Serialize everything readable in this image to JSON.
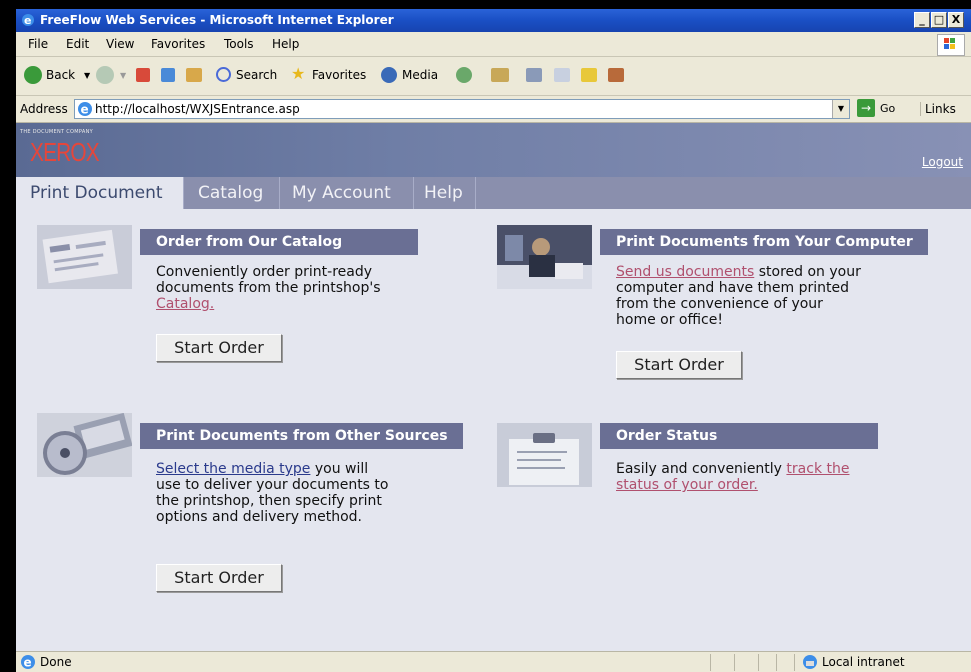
{
  "window": {
    "title": "FreeFlow Web Services - Microsoft Internet Explorer",
    "buttons": [
      "_",
      "□",
      "X"
    ]
  },
  "menubar": [
    "File",
    "Edit",
    "View",
    "Favorites",
    "Tools",
    "Help"
  ],
  "toolbar": {
    "back": "Back",
    "search": "Search",
    "favorites": "Favorites",
    "media": "Media"
  },
  "address": {
    "label": "Address",
    "url": "http://localhost/WXJSEntrance.asp",
    "go": "Go",
    "links": "Links"
  },
  "banner": {
    "tagline": "THE DOCUMENT COMPANY",
    "logo": "XEROX",
    "logout": "Logout"
  },
  "tabs": [
    "Print Document",
    "Catalog",
    "My Account",
    "Help"
  ],
  "panels": {
    "catalog": {
      "title": "Order from Our Catalog",
      "text1": "Conveniently order print-ready documents from the printshop's ",
      "link": "Catalog.",
      "button": "Start Order"
    },
    "computer": {
      "title": "Print Documents from Your Computer",
      "link": "Send us documents",
      "text": " stored on your computer and have them printed from the convenience of your home or office!",
      "button": "Start Order"
    },
    "other": {
      "title": "Print Documents from Other Sources",
      "link": "Select the media type",
      "text": " you will use to deliver your documents to the printshop, then specify print options and delivery method.",
      "button": "Start Order"
    },
    "status": {
      "title": "Order Status",
      "text": "Easily and conveniently ",
      "link": "track the status of your order."
    }
  },
  "statusbar": {
    "status": "Done",
    "zone": "Local intranet"
  }
}
